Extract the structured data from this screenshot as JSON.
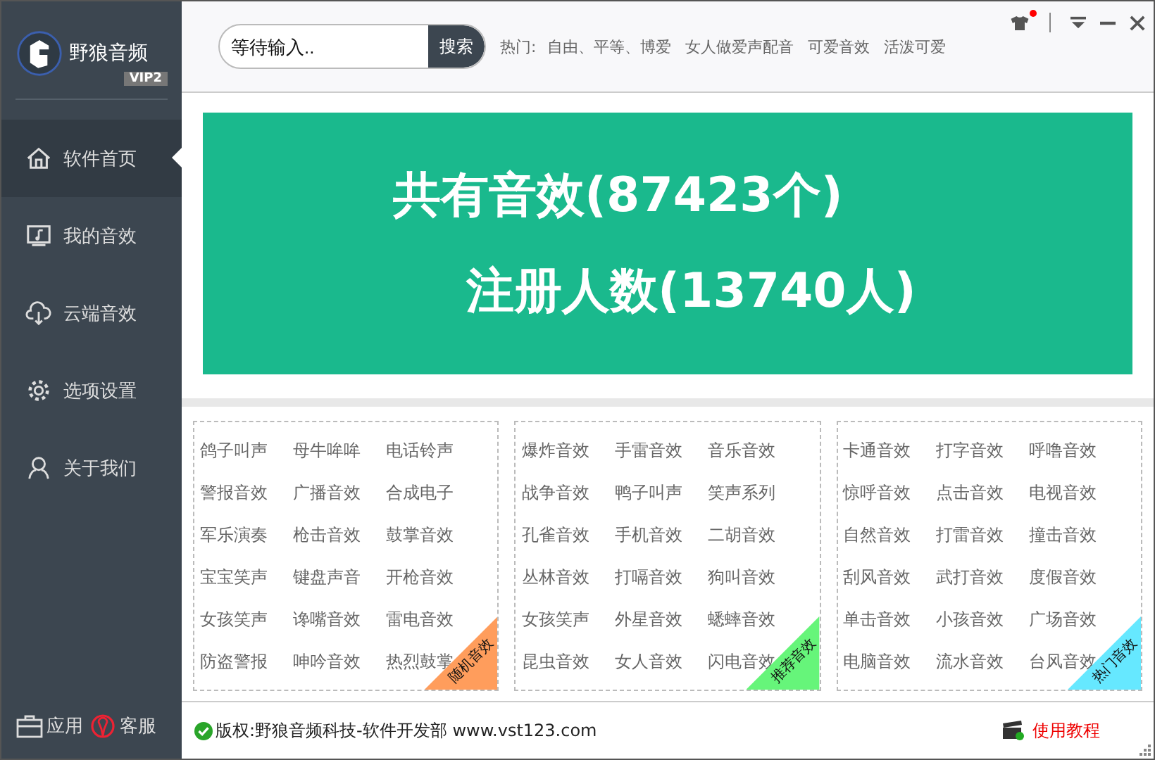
{
  "app": {
    "name": "野狼音频",
    "badge": "VIP2"
  },
  "sidebar": {
    "items": [
      {
        "label": "软件首页",
        "selected": true
      },
      {
        "label": "我的音效",
        "selected": false
      },
      {
        "label": "云端音效",
        "selected": false
      },
      {
        "label": "选项设置",
        "selected": false
      },
      {
        "label": "关于我们",
        "selected": false
      }
    ],
    "bottom": [
      {
        "label": "应用"
      },
      {
        "label": "客服"
      }
    ]
  },
  "search": {
    "placeholder": "等待输入..",
    "button": "搜索"
  },
  "hot": {
    "label": "热门:",
    "items": [
      "自由、平等、博爱",
      "女人做爱声配音",
      "可爱音效",
      "活泼可爱"
    ]
  },
  "banner": {
    "lines": [
      "共有音效(87423个)",
      "注册人数(13740人)"
    ]
  },
  "panels": [
    {
      "ribbon": "随机音效",
      "color": "#ff9d5c",
      "items": [
        "鸽子叫声",
        "母牛哞哞",
        "电话铃声",
        "警报音效",
        "广播音效",
        "合成电子",
        "军乐演奏",
        "枪击音效",
        "鼓掌音效",
        "宝宝笑声",
        "键盘声音",
        "开枪音效",
        "女孩笑声",
        "谗嘴音效",
        "雷电音效",
        "防盗警报",
        "呻吟音效",
        "热烈鼓掌"
      ]
    },
    {
      "ribbon": "推荐音效",
      "color": "#66f57a",
      "items": [
        "爆炸音效",
        "手雷音效",
        "音乐音效",
        "战争音效",
        "鸭子叫声",
        "笑声系列",
        "孔雀音效",
        "手机音效",
        "二胡音效",
        "丛林音效",
        "打嗝音效",
        "狗叫音效",
        "女孩笑声",
        "外星音效",
        "蟋蟀音效",
        "昆虫音效",
        "女人音效",
        "闪电音效"
      ]
    },
    {
      "ribbon": "热门音效",
      "color": "#66e8ff",
      "items": [
        "卡通音效",
        "打字音效",
        "呼噜音效",
        "惊呼音效",
        "点击音效",
        "电视音效",
        "自然音效",
        "打雷音效",
        "撞击音效",
        "刮风音效",
        "武打音效",
        "度假音效",
        "单击音效",
        "小孩音效",
        "广场音效",
        "电脑音效",
        "流水音效",
        "台风音效"
      ]
    }
  ],
  "footer": {
    "copyright": "版权:野狼音频科技-软件开发部 www.vst123.com",
    "tutorial": "使用教程"
  },
  "notification": {
    "unread": true
  }
}
